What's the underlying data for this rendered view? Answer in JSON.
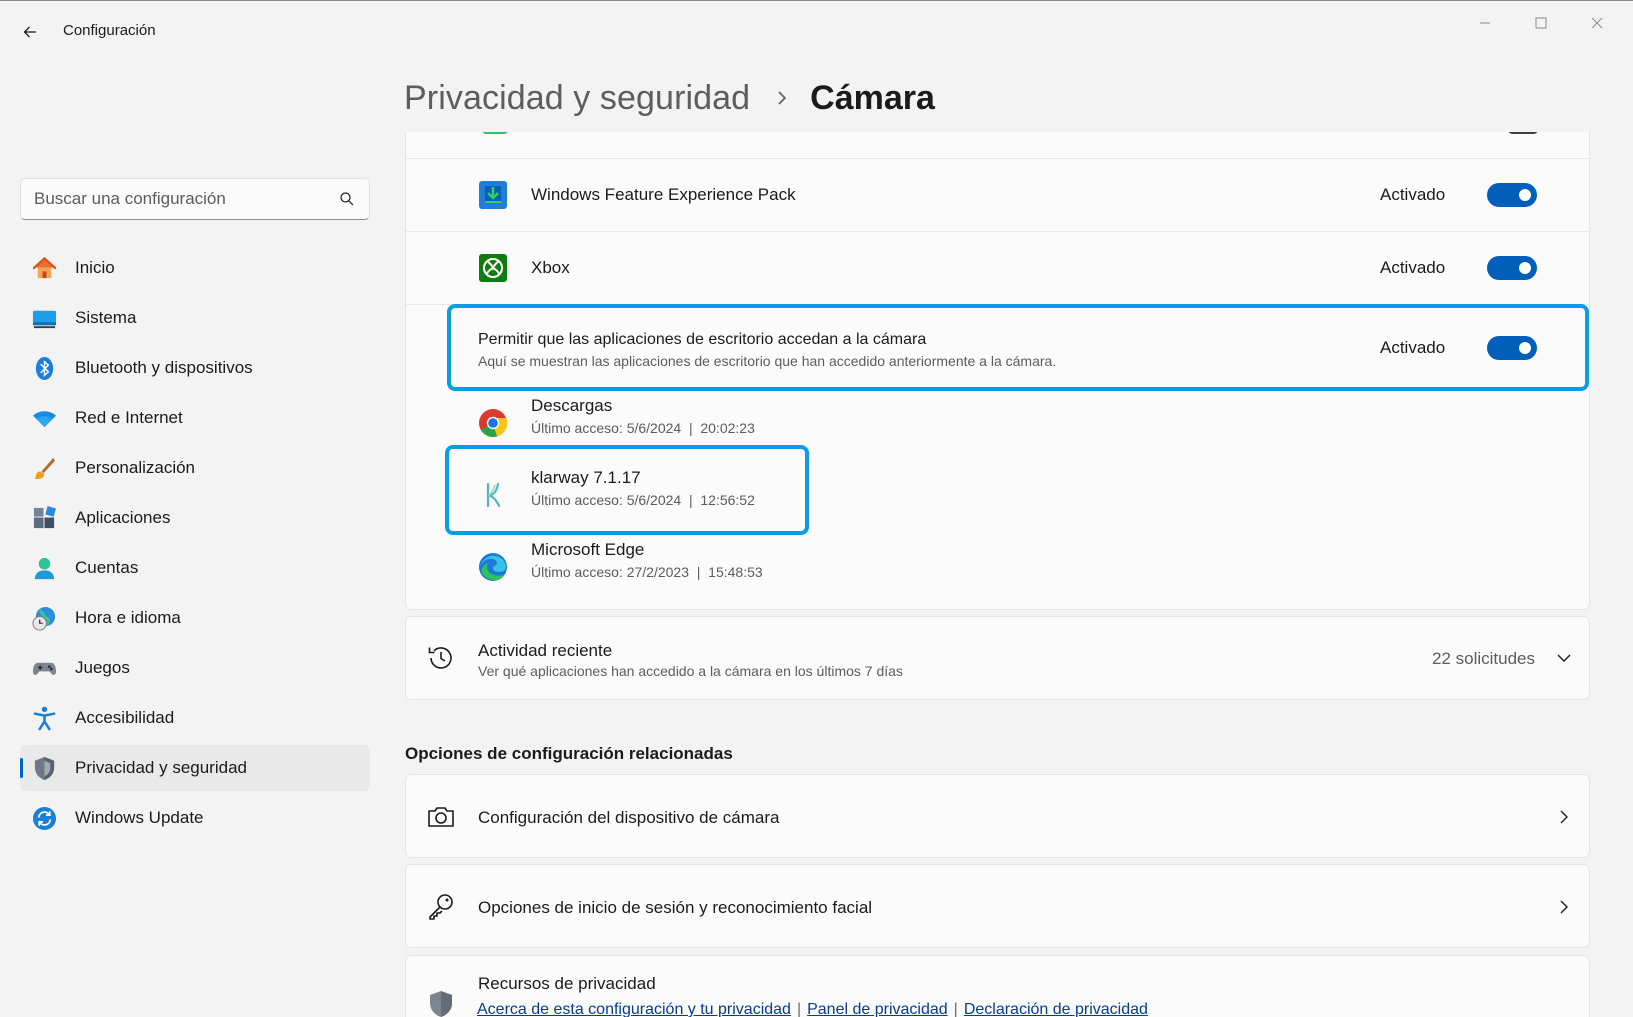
{
  "window": {
    "app_title": "Configuración",
    "controls": {
      "minimize": "minimize-icon",
      "maximize": "maximize-icon",
      "close": "close-icon"
    }
  },
  "breadcrumb": {
    "parent": "Privacidad y seguridad",
    "current": "Cámara"
  },
  "search": {
    "placeholder": "Buscar una configuración",
    "value": ""
  },
  "sidebar": {
    "items": [
      {
        "label": "Inicio",
        "icon": "home-icon"
      },
      {
        "label": "Sistema",
        "icon": "monitor-icon"
      },
      {
        "label": "Bluetooth y dispositivos",
        "icon": "bluetooth-icon"
      },
      {
        "label": "Red e Internet",
        "icon": "wifi-icon"
      },
      {
        "label": "Personalización",
        "icon": "paintbrush-icon"
      },
      {
        "label": "Aplicaciones",
        "icon": "apps-icon"
      },
      {
        "label": "Cuentas",
        "icon": "account-icon"
      },
      {
        "label": "Hora e idioma",
        "icon": "clock-globe-icon"
      },
      {
        "label": "Juegos",
        "icon": "gamepad-icon"
      },
      {
        "label": "Accesibilidad",
        "icon": "accessibility-icon"
      },
      {
        "label": "Privacidad y seguridad",
        "icon": "shield-icon",
        "active": true
      },
      {
        "label": "Windows Update",
        "icon": "update-icon"
      }
    ]
  },
  "apps": [
    {
      "name": "Windows Feature Experience Pack",
      "state": "Activado",
      "on": true,
      "icon": "feature-pack-icon"
    },
    {
      "name": "Xbox",
      "state": "Activado",
      "on": true,
      "icon": "xbox-icon"
    }
  ],
  "desktop_apps": {
    "title": "Permitir que las aplicaciones de escritorio accedan a la cámara",
    "subtitle": "Aquí se muestran las aplicaciones de escritorio que han accedido anteriormente a la cámara.",
    "state": "Activado",
    "on": true
  },
  "recent_apps": [
    {
      "name": "Descargas",
      "last_access": "Último acceso: 5/6/2024  |  20:02:23",
      "icon": "chrome-icon"
    },
    {
      "name": "klarway 7.1.17",
      "last_access": "Último acceso: 5/6/2024  |  12:56:52",
      "icon": "klarway-icon"
    },
    {
      "name": "Microsoft Edge",
      "last_access": "Último acceso: 27/2/2023  |  15:48:53",
      "icon": "edge-icon"
    }
  ],
  "activity": {
    "title": "Actividad reciente",
    "subtitle": "Ver qué aplicaciones han accedido a la cámara en los últimos 7 días",
    "count": "22 solicitudes"
  },
  "related": {
    "heading": "Opciones de configuración relacionadas",
    "items": [
      {
        "label": "Configuración del dispositivo de cámara",
        "icon": "camera-icon"
      },
      {
        "label": "Opciones de inicio de sesión y reconocimiento facial",
        "icon": "key-icon"
      }
    ],
    "resources": {
      "title": "Recursos de privacidad",
      "links": [
        "Acerca de esta configuración y tu privacidad",
        "Panel de privacidad",
        "Declaración de privacidad"
      ]
    }
  },
  "colors": {
    "accent": "#005fb8",
    "highlight": "#0a9ee0",
    "background": "#f3f3f3",
    "card": "#fbfbfb"
  }
}
